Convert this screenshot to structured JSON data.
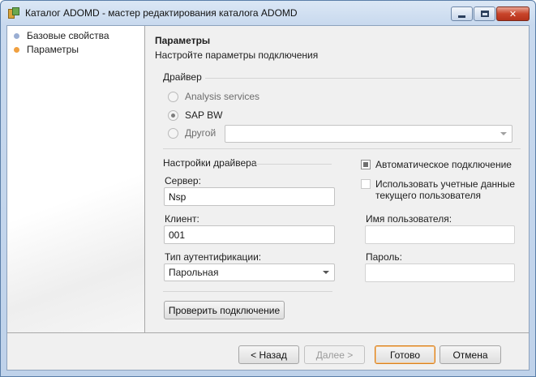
{
  "window": {
    "title": "Каталог ADOMD - мастер редактирования каталога ADOMD",
    "minimize_icon": "minimize-icon",
    "maximize_icon": "maximize-icon",
    "close_icon": "close-icon",
    "close_glyph": "✕"
  },
  "sidebar": {
    "items": [
      {
        "label": "Базовые свойства",
        "bullet_color": "#9aaed3",
        "selected": false
      },
      {
        "label": "Параметры",
        "bullet_color": "#f0a040",
        "selected": true
      }
    ]
  },
  "page": {
    "title": "Параметры",
    "subtitle": "Настройте параметры подключения"
  },
  "driver": {
    "group_label": "Драйвер",
    "options": [
      {
        "label": "Analysis services",
        "checked": false
      },
      {
        "label": "SAP BW",
        "checked": true
      },
      {
        "label": "Другой",
        "checked": false
      }
    ],
    "other_value": ""
  },
  "driver_settings": {
    "group_label": "Настройки драйвера",
    "server_label": "Сервер:",
    "server_value": "Nsp",
    "client_label": "Клиент:",
    "client_value": "001",
    "auth_label": "Тип аутентификации:",
    "auth_value": "Парольная"
  },
  "auth": {
    "auto_connect_label": "Автоматическое подключение",
    "auto_connect_checked": true,
    "use_current_user_label": "Использовать учетные данные текущего пользователя",
    "use_current_user_checked": false,
    "username_label": "Имя пользователя:",
    "username_value": "",
    "password_label": "Пароль:",
    "password_value": ""
  },
  "buttons": {
    "test_connection": "Проверить подключение",
    "back": "< Назад",
    "next": "Далее >",
    "finish": "Готово",
    "cancel": "Отмена"
  },
  "colors": {
    "accent_orange": "#f0a040",
    "bullet_blue": "#9aaed3"
  }
}
